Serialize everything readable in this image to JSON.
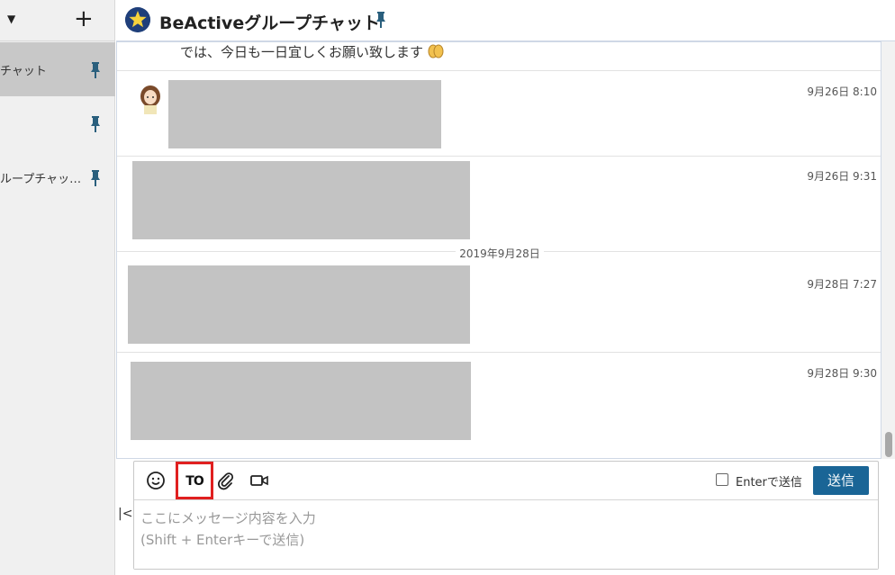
{
  "sidebar": {
    "caret": "▼",
    "add": "+",
    "items": [
      {
        "label": "チャット",
        "active": true
      },
      {
        "label": "",
        "active": false
      },
      {
        "label": "ループチャッ…",
        "active": false
      }
    ]
  },
  "header": {
    "title": "BeActiveグループチャット",
    "icon": "star-icon"
  },
  "timeline": {
    "partial_message": "では、今日も一日宜しくお願い致します",
    "messages": [
      {
        "time": "9月26日 8:10"
      },
      {
        "time": "9月26日 9:31"
      },
      {
        "time": "9月28日 7:27"
      },
      {
        "time": "9月28日 9:30"
      }
    ],
    "date_separator": "2019年9月28日"
  },
  "composer": {
    "to_label": "TO",
    "enter_to_send_label": "Enterで送信",
    "send_label": "送信",
    "placeholder": "ここにメッセージ内容を入力\n(Shift + Enterキーで送信)",
    "collapse": "|<"
  },
  "colors": {
    "accent": "#1a6596",
    "highlight": "#e02020",
    "pin": "#2a5f7d",
    "redacted": "#c3c3c3"
  }
}
